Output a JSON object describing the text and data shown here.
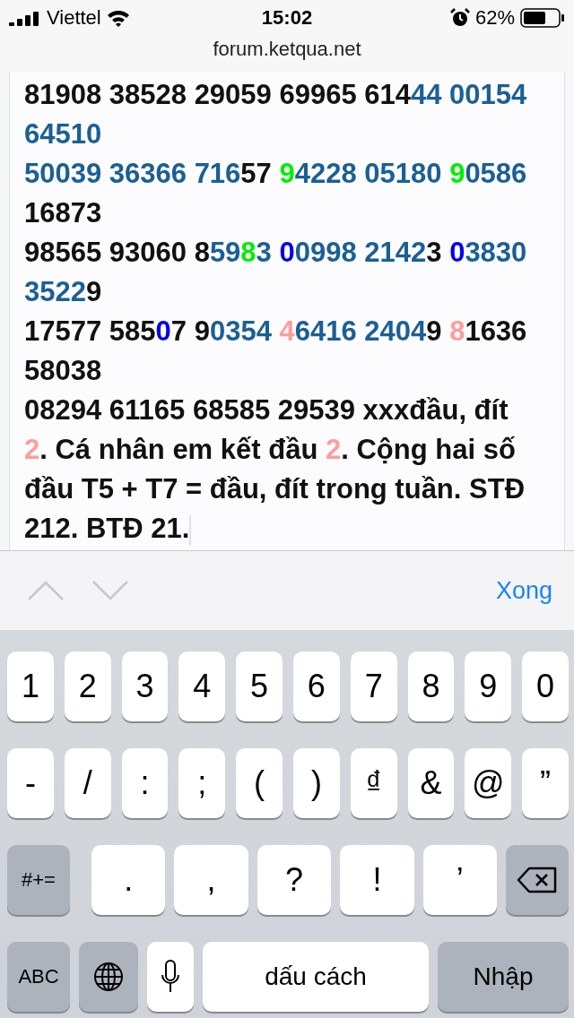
{
  "status_bar": {
    "carrier": "Viettel",
    "time": "15:02",
    "battery": "62%"
  },
  "address_bar": {
    "url": "forum.ketqua.net"
  },
  "editor": {
    "lines": [
      [
        {
          "text": "81908 38528 29059 69965 614",
          "color": "#111111"
        },
        {
          "text": "44 00154",
          "color": "#1b5f95"
        }
      ],
      [
        {
          "text": "64510",
          "color": "#1b5f95"
        }
      ],
      [
        {
          "text": "50039 36366 716",
          "color": "#1b5f95"
        },
        {
          "text": "57 ",
          "color": "#111111"
        },
        {
          "text": "9",
          "color": "#00ee00"
        },
        {
          "text": "4228 05180 ",
          "color": "#1b5f95"
        },
        {
          "text": "9",
          "color": "#00ee00"
        },
        {
          "text": "0586",
          "color": "#1b5f95"
        }
      ],
      [
        {
          "text": "16873",
          "color": "#111111"
        }
      ],
      [
        {
          "text": "98565 93060 8",
          "color": "#111111"
        },
        {
          "text": "59",
          "color": "#1b5f95"
        },
        {
          "text": "8",
          "color": "#00ee00"
        },
        {
          "text": "3 ",
          "color": "#1b5f95"
        },
        {
          "text": "0",
          "color": "#0000ee"
        },
        {
          "text": "0998 2142",
          "color": "#1b5f95"
        },
        {
          "text": "3 ",
          "color": "#111111"
        },
        {
          "text": "0",
          "color": "#0000ee"
        },
        {
          "text": "3830",
          "color": "#1b5f95"
        }
      ],
      [
        {
          "text": "3522",
          "color": "#1b5f95"
        },
        {
          "text": "9",
          "color": "#111111"
        }
      ],
      [
        {
          "text": "17577 585",
          "color": "#111111"
        },
        {
          "text": "0",
          "color": "#0000ee"
        },
        {
          "text": "7 9",
          "color": "#111111"
        },
        {
          "text": "0354 ",
          "color": "#1b5f95"
        },
        {
          "text": "4",
          "color": "#ff9c9c"
        },
        {
          "text": "6416 2404",
          "color": "#1b5f95"
        },
        {
          "text": "9 ",
          "color": "#111111"
        },
        {
          "text": "8",
          "color": "#ff9c9c"
        },
        {
          "text": "1636",
          "color": "#111111"
        }
      ],
      [
        {
          "text": "58038",
          "color": "#111111"
        }
      ],
      [
        {
          "text": "08294 61165 68585 29539 xxxđầu, đít",
          "color": "#111111"
        }
      ],
      [
        {
          "text": "2",
          "color": "#ff9c9c"
        },
        {
          "text": ". Cá nhân em kết đầu ",
          "color": "#111111"
        },
        {
          "text": "2",
          "color": "#ff9c9c"
        },
        {
          "text": ". Cộng hai số",
          "color": "#111111"
        }
      ],
      [
        {
          "text": "đầu T5 + T7 = đầu, đít trong tuần. STĐ",
          "color": "#111111"
        }
      ],
      [
        {
          "text": "212. BTĐ 21.",
          "color": "#111111"
        }
      ]
    ]
  },
  "toolbar": {
    "previous": {
      "disabled": true
    },
    "next": {
      "disabled": true
    },
    "done": "Xong"
  },
  "keyboard": {
    "rows": [
      {
        "keys": [
          {
            "kind": "char",
            "label": "1"
          },
          {
            "kind": "char",
            "label": "2"
          },
          {
            "kind": "char",
            "label": "3"
          },
          {
            "kind": "char",
            "label": "4"
          },
          {
            "kind": "char",
            "label": "5"
          },
          {
            "kind": "char",
            "label": "6"
          },
          {
            "kind": "char",
            "label": "7"
          },
          {
            "kind": "char",
            "label": "8"
          },
          {
            "kind": "char",
            "label": "9"
          },
          {
            "kind": "char",
            "label": "0"
          }
        ]
      },
      {
        "keys": [
          {
            "kind": "char",
            "label": "-"
          },
          {
            "kind": "char",
            "label": "/"
          },
          {
            "kind": "char",
            "label": ":"
          },
          {
            "kind": "char",
            "label": ";"
          },
          {
            "kind": "char",
            "label": "("
          },
          {
            "kind": "char",
            "label": ")"
          },
          {
            "kind": "char",
            "label": "₫"
          },
          {
            "kind": "char",
            "label": "&"
          },
          {
            "kind": "char",
            "label": "@"
          },
          {
            "kind": "char",
            "label": "”"
          }
        ]
      },
      {
        "keys": [
          {
            "kind": "function",
            "label": "#+="
          },
          {
            "kind": "char",
            "label": "."
          },
          {
            "kind": "char",
            "label": ","
          },
          {
            "kind": "char",
            "label": "?"
          },
          {
            "kind": "char",
            "label": "!"
          },
          {
            "kind": "char",
            "label": "’"
          },
          {
            "kind": "backspace"
          }
        ]
      },
      {
        "keys": [
          {
            "kind": "function",
            "label": "ABC"
          },
          {
            "kind": "globe"
          },
          {
            "kind": "mic"
          },
          {
            "kind": "space",
            "label": "dấu cách"
          },
          {
            "kind": "return",
            "label": "Nhập"
          }
        ]
      }
    ]
  }
}
